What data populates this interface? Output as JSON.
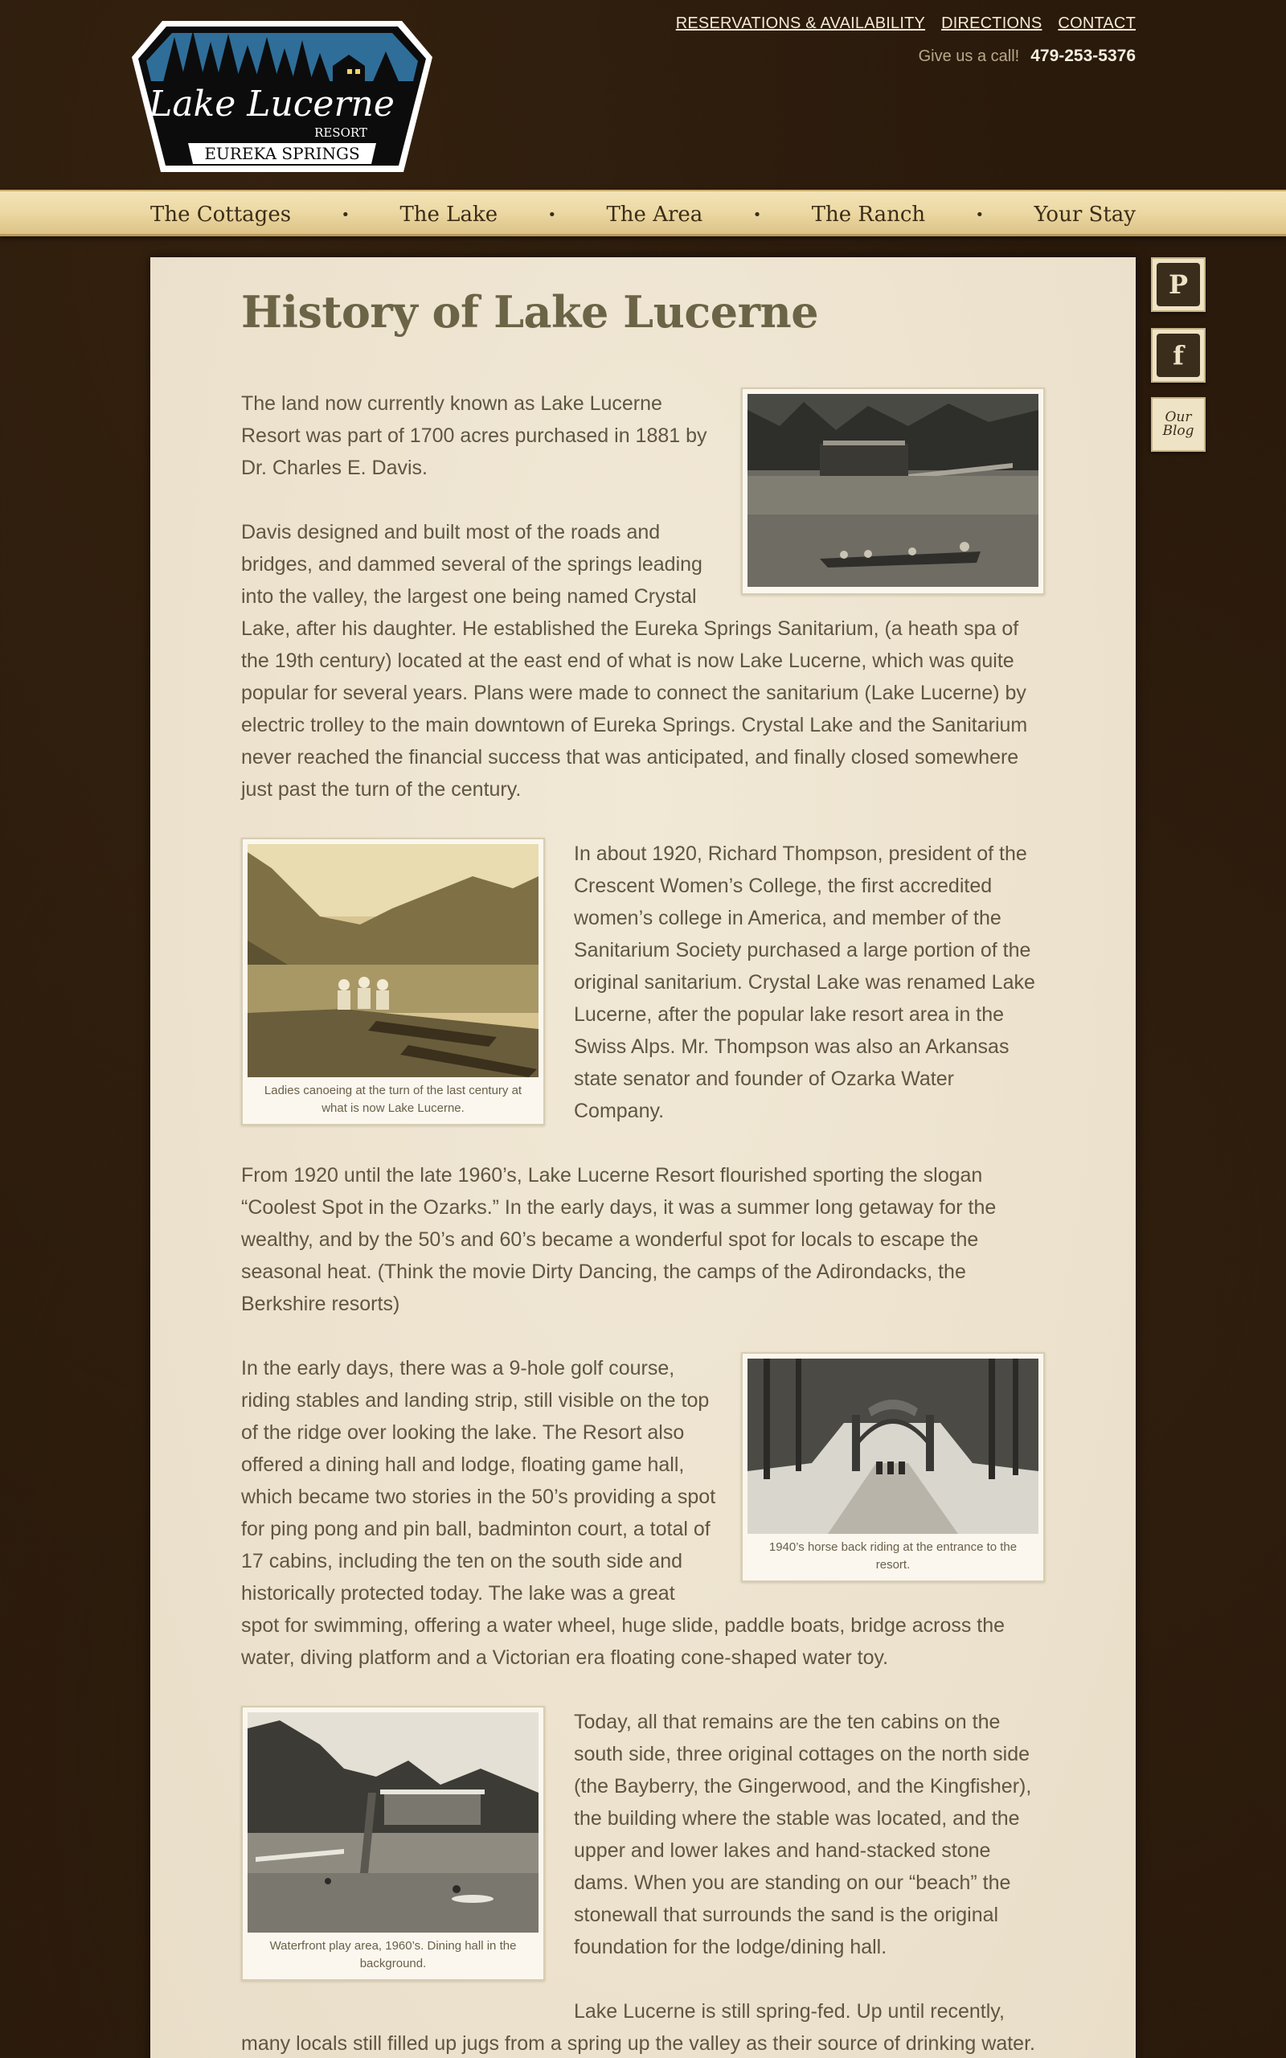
{
  "header": {
    "logo": {
      "script_text": "Lake Lucerne",
      "resort_text": "RESORT",
      "banner_text": "EUREKA SPRINGS"
    },
    "top_links": [
      "RESERVATIONS & AVAILABILITY",
      "DIRECTIONS",
      "CONTACT"
    ],
    "call_label": "Give us a call!",
    "phone": "479-253-5376"
  },
  "nav": {
    "items": [
      "The Cottages",
      "The Lake",
      "The Area",
      "The Ranch",
      "Your Stay"
    ],
    "separator": "•"
  },
  "social": {
    "pinterest_letter": "P",
    "facebook_letter": "f",
    "blog_line1": "Our",
    "blog_line2": "Blog"
  },
  "page": {
    "title": "History of Lake Lucerne",
    "paragraphs": [
      "The land now currently known as Lake Lucerne Resort was part of 1700 acres purchased in 1881 by Dr. Charles E. Davis.",
      "Davis designed and built most of the roads and bridges, and dammed several of the springs leading into the valley, the largest one being named Crystal Lake, after his daughter. He established the Eureka Springs Sanitarium, (a heath spa of the 19th century) located at the east end of what is now Lake Lucerne, which was quite popular for several years. Plans were made to connect the sanitarium (Lake Lucerne) by electric trolley to the main downtown of Eureka Springs. Crystal Lake and the Sanitarium never reached the financial success that was anticipated, and finally closed somewhere just past the turn of the century.",
      "In about 1920, Richard Thompson, president of the Crescent Women’s College, the first accredited women’s college in America, and member of the Sanitarium Society purchased a large portion of the original sanitarium. Crystal Lake was renamed Lake Lucerne, after the popular lake resort area in the Swiss Alps. Mr. Thompson was also an Arkansas state senator and founder of Ozarka Water Company.",
      "From 1920 until the late 1960’s, Lake Lucerne Resort flourished sporting the slogan “Coolest Spot in the Ozarks.” In the early days, it was a summer long getaway for the wealthy, and by the 50’s and 60’s became a wonderful spot for locals to escape the seasonal heat. (Think the movie Dirty Dancing, the camps of the Adirondacks, the Berkshire resorts)",
      "In the early days, there was a 9-hole golf course, riding stables and landing strip, still visible on the top of the ridge over looking the lake. The Resort also offered a dining hall and lodge, floating game hall, which became two stories in the 50’s providing a spot for ping pong and pin ball, badminton court, a total of 17 cabins, including the ten on the south side and historically protected today. The lake was a great spot for swimming, offering a water wheel, huge slide, paddle boats, bridge across the water, diving platform and a Victorian era floating cone-shaped water toy.",
      "Today, all that remains are the ten cabins on the south side, three original cottages on the north side (the Bayberry, the Gingerwood, and the Kingfisher), the building where the stable was located, and the upper and lower lakes and hand-stacked stone dams. When you are standing on our “beach” the stonewall that surrounds the sand is the original foundation for the lodge/dining hall.",
      "Lake Lucerne is still spring-fed. Up until recently, many locals still filled up jugs from a spring up the valley as their source of drinking water."
    ],
    "captions": {
      "canoeing": "Ladies canoeing at the turn of the last century at what is now Lake Lucerne.",
      "horseback": "1940’s horse back riding at the entrance to the resort.",
      "waterfront": "Waterfront play area, 1960’s. Dining hall in the background."
    },
    "photo_names": [
      "lake-boathouse-photo",
      "ladies-canoeing-photo",
      "horseback-entrance-photo",
      "waterfront-play-area-photo"
    ]
  },
  "colors": {
    "background": "#2a1a0c",
    "nav_bar": "#ecd8a3",
    "panel": "#ede3cf",
    "title": "#6b6446",
    "body_text": "#5f5540",
    "logo_sky": "#2f6e99"
  }
}
